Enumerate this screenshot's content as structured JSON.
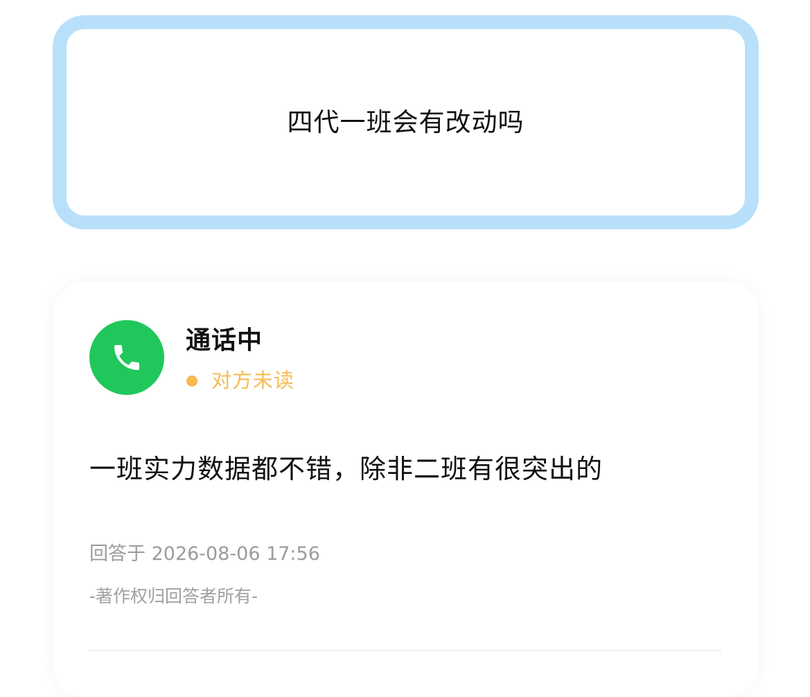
{
  "question": {
    "text": "四代一班会有改动吗"
  },
  "answer": {
    "responder": {
      "name": "通话中",
      "avatar_icon": "phone-icon",
      "avatar_color": "#20c85b"
    },
    "read_status": {
      "text": "对方未读",
      "color": "#f4bc55"
    },
    "body": "一班实力数据都不错，除非二班有很突出的",
    "timestamp": "回答于 2026-08-06 17:56",
    "copyright": "-著作权归回答者所有-"
  },
  "colors": {
    "question_border": "#b8e0fb",
    "status_dot": "#f9b94c"
  }
}
